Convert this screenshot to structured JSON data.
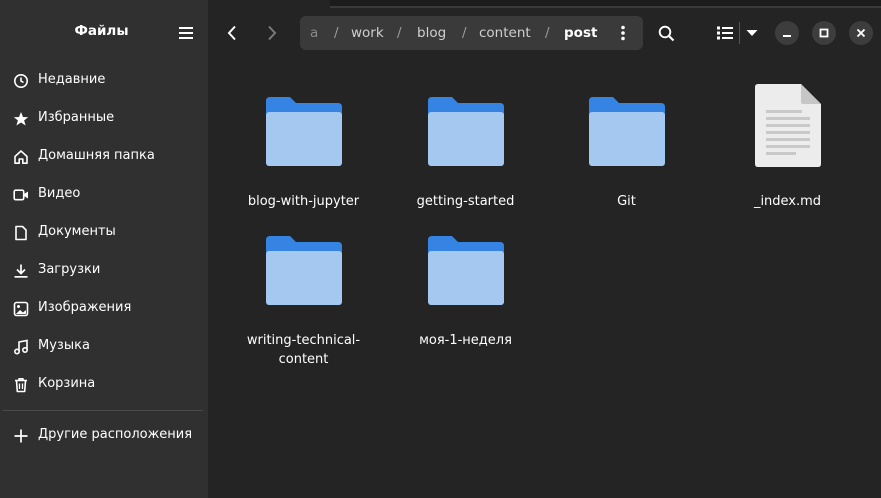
{
  "sidebar": {
    "title": "Файлы",
    "items": [
      {
        "label": "Недавние",
        "icon": "clock-icon"
      },
      {
        "label": "Избранные",
        "icon": "star-icon"
      },
      {
        "label": "Домашняя папка",
        "icon": "home-icon"
      },
      {
        "label": "Видео",
        "icon": "video-icon"
      },
      {
        "label": "Документы",
        "icon": "document-icon"
      },
      {
        "label": "Загрузки",
        "icon": "download-icon"
      },
      {
        "label": "Изображения",
        "icon": "image-icon"
      },
      {
        "label": "Музыка",
        "icon": "music-icon"
      },
      {
        "label": "Корзина",
        "icon": "trash-icon"
      }
    ],
    "other_locations": {
      "label": "Другие расположения",
      "icon": "plus-icon"
    }
  },
  "pathbar": {
    "crumbs": [
      "a",
      "work",
      "blog",
      "content",
      "post"
    ],
    "separator": "/"
  },
  "files": [
    {
      "name": "blog-with-jupyter",
      "type": "folder"
    },
    {
      "name": "getting-started",
      "type": "folder"
    },
    {
      "name": "Git",
      "type": "folder"
    },
    {
      "name": "_index.md",
      "type": "text-file"
    },
    {
      "name": "writing-technical-content",
      "type": "folder"
    },
    {
      "name": "моя-1-неделя",
      "type": "folder"
    }
  ],
  "colors": {
    "folder_back": "#3584e4",
    "folder_front": "#a4c8f0",
    "sidebar_bg": "#303030",
    "content_bg": "#242424"
  }
}
